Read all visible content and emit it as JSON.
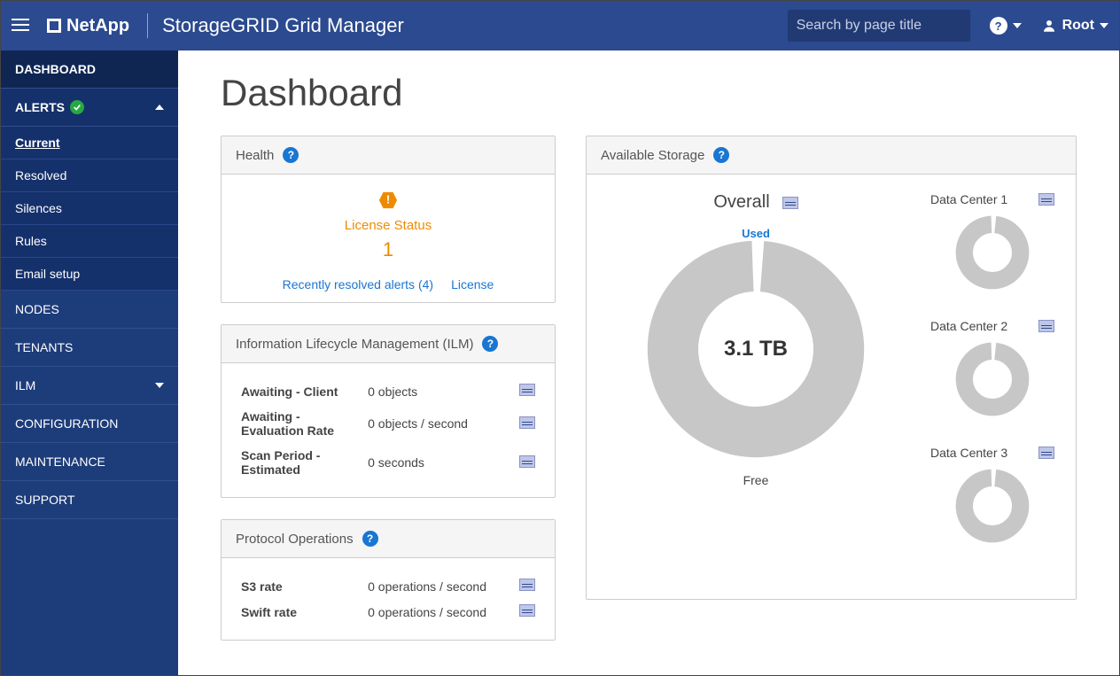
{
  "topbar": {
    "brand": "NetApp",
    "app_title": "StorageGRID Grid Manager",
    "search_placeholder": "Search by page title",
    "user_label": "Root"
  },
  "sidebar": {
    "dashboard": "DASHBOARD",
    "alerts": "ALERTS",
    "alerts_sub": {
      "current": "Current",
      "resolved": "Resolved",
      "silences": "Silences",
      "rules": "Rules",
      "email": "Email setup"
    },
    "nodes": "NODES",
    "tenants": "TENANTS",
    "ilm": "ILM",
    "configuration": "CONFIGURATION",
    "maintenance": "MAINTENANCE",
    "support": "SUPPORT"
  },
  "page": {
    "title": "Dashboard"
  },
  "health": {
    "title": "Health",
    "license_status_label": "License Status",
    "license_count": "1",
    "recent_alerts_link": "Recently resolved alerts (4)",
    "license_link": "License"
  },
  "ilm_card": {
    "title": "Information Lifecycle Management (ILM)",
    "rows": [
      {
        "label": "Awaiting - Client",
        "value": "0 objects"
      },
      {
        "label": "Awaiting - Evaluation Rate",
        "value": "0 objects / second"
      },
      {
        "label": "Scan Period - Estimated",
        "value": "0 seconds"
      }
    ]
  },
  "protocol": {
    "title": "Protocol Operations",
    "rows": [
      {
        "label": "S3 rate",
        "value": "0 operations / second"
      },
      {
        "label": "Swift rate",
        "value": "0 operations / second"
      }
    ]
  },
  "storage": {
    "title": "Available Storage",
    "overall_label": "Overall",
    "used_label": "Used",
    "free_label": "Free",
    "total": "3.1 TB",
    "datacenters": [
      {
        "name": "Data Center 1"
      },
      {
        "name": "Data Center 2"
      },
      {
        "name": "Data Center 3"
      }
    ]
  },
  "chart_data": {
    "type": "pie",
    "title": "Available Storage — Overall",
    "total_label": "3.1 TB",
    "series": [
      {
        "name": "Used",
        "fraction": 0.02
      },
      {
        "name": "Free",
        "fraction": 0.98
      }
    ],
    "subcharts": [
      {
        "name": "Data Center 1",
        "used_fraction": 0.02
      },
      {
        "name": "Data Center 2",
        "used_fraction": 0.02
      },
      {
        "name": "Data Center 3",
        "used_fraction": 0.02
      }
    ]
  }
}
